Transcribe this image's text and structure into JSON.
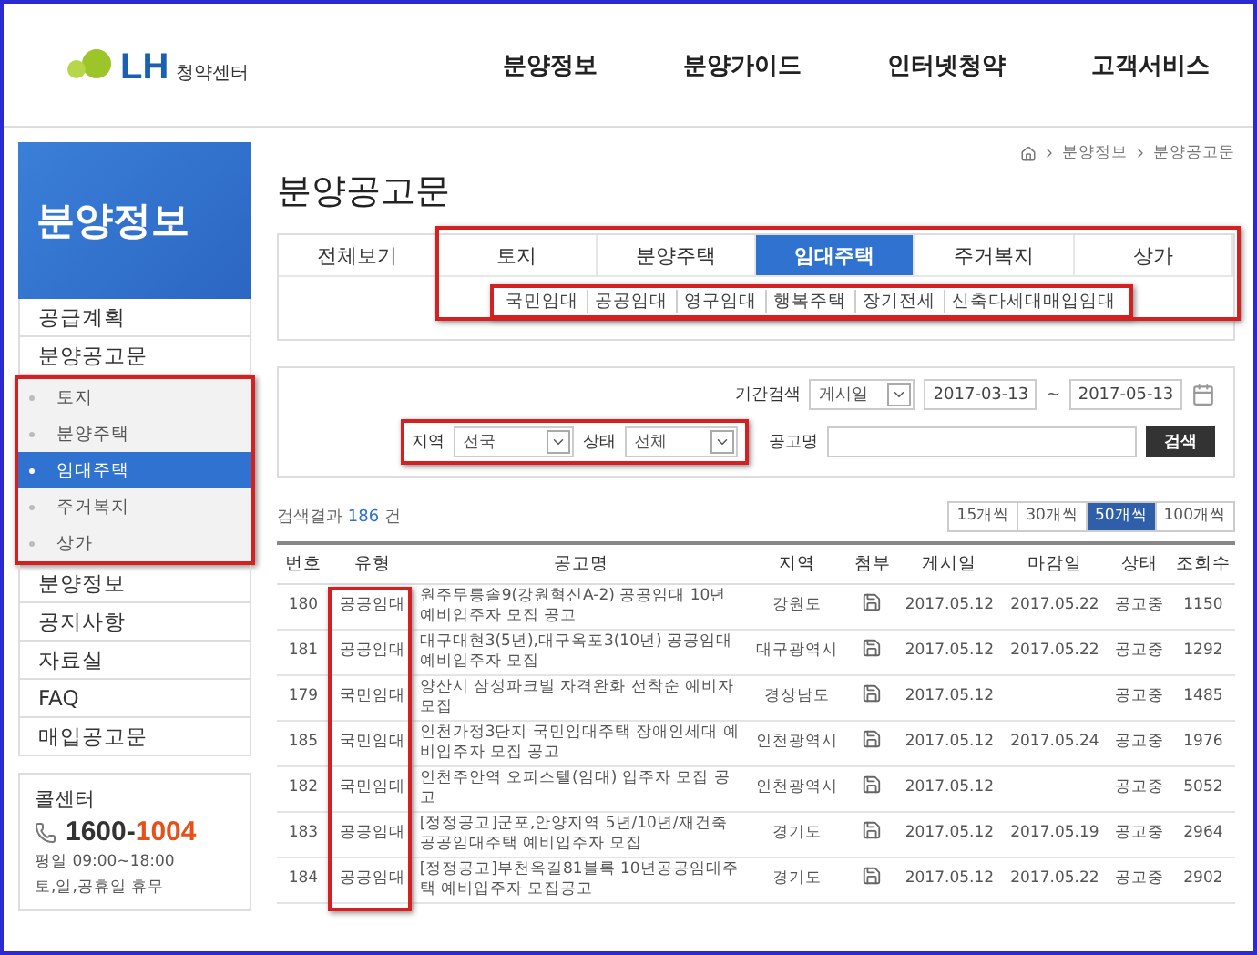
{
  "header": {
    "logo": {
      "brand": "LH",
      "sub": "청약센터"
    },
    "nav": [
      "분양정보",
      "분양가이드",
      "인터넷청약",
      "고객서비스"
    ]
  },
  "sidebar": {
    "title": "분양정보",
    "menu": [
      {
        "label": "공급계획"
      },
      {
        "label": "분양공고문",
        "children": [
          {
            "label": "토지",
            "selected": false
          },
          {
            "label": "분양주택",
            "selected": false
          },
          {
            "label": "임대주택",
            "selected": true
          },
          {
            "label": "주거복지",
            "selected": false
          },
          {
            "label": "상가",
            "selected": false
          }
        ]
      },
      {
        "label": "분양정보"
      },
      {
        "label": "공지사항"
      },
      {
        "label": "자료실"
      },
      {
        "label": "FAQ"
      },
      {
        "label": "매입공고문"
      }
    ],
    "call_center": {
      "title": "콜센터",
      "phone_prefix": "1600-",
      "phone_suffix": "1004",
      "hours": [
        "평일 09:00~18:00",
        "토,일,공휴일 휴무"
      ]
    }
  },
  "breadcrumb": [
    "분양정보",
    "분양공고문"
  ],
  "page_title": "분양공고문",
  "tabs": [
    {
      "label": "전체보기",
      "selected": false
    },
    {
      "label": "토지",
      "selected": false
    },
    {
      "label": "분양주택",
      "selected": false
    },
    {
      "label": "임대주택",
      "selected": true
    },
    {
      "label": "주거복지",
      "selected": false
    },
    {
      "label": "상가",
      "selected": false
    }
  ],
  "subtabs": [
    "국민임대",
    "공공임대",
    "영구임대",
    "행복주택",
    "장기전세",
    "신축다세대매입임대"
  ],
  "filters": {
    "period_label": "기간검색",
    "period_type": "게시일",
    "date_from": "2017-03-13",
    "date_separator": "~",
    "date_to": "2017-05-13",
    "region_label": "지역",
    "region": "전국",
    "status_label": "상태",
    "status": "전체",
    "title_label": "공고명",
    "search_button": "검색"
  },
  "result": {
    "prefix": "검색결과",
    "count": "186",
    "suffix": "건"
  },
  "page_sizes": [
    {
      "label": "15개씩",
      "selected": false
    },
    {
      "label": "30개씩",
      "selected": false
    },
    {
      "label": "50개씩",
      "selected": true
    },
    {
      "label": "100개씩",
      "selected": false
    }
  ],
  "table": {
    "columns": [
      "번호",
      "유형",
      "공고명",
      "지역",
      "첨부",
      "게시일",
      "마감일",
      "상태",
      "조회수"
    ],
    "rows": [
      {
        "no": "180",
        "type": "공공임대",
        "title": "원주무릉솔9(강원혁신A-2) 공공임대 10년 예비입주자 모집 공고",
        "region": "강원도",
        "attachment": true,
        "posted": "2017.05.12",
        "deadline": "2017.05.22",
        "status": "공고중",
        "views": "1150"
      },
      {
        "no": "181",
        "type": "공공임대",
        "title": "대구대현3(5년),대구옥포3(10년) 공공임대 예비입주자 모집",
        "region": "대구광역시",
        "attachment": true,
        "posted": "2017.05.12",
        "deadline": "2017.05.22",
        "status": "공고중",
        "views": "1292"
      },
      {
        "no": "179",
        "type": "국민임대",
        "title": "양산시 삼성파크빌 자격완화 선착순 예비자모집",
        "region": "경상남도",
        "attachment": true,
        "posted": "2017.05.12",
        "status": "공고중",
        "views": "1485"
      },
      {
        "no": "185",
        "type": "국민임대",
        "title": "인천가정3단지 국민임대주택 장애인세대 예비입주자 모집 공고",
        "region": "인천광역시",
        "attachment": true,
        "posted": "2017.05.12",
        "deadline": "2017.05.24",
        "status": "공고중",
        "views": "1976"
      },
      {
        "no": "182",
        "type": "국민임대",
        "title": "인천주안역 오피스텔(임대) 입주자 모집 공고",
        "region": "인천광역시",
        "attachment": true,
        "posted": "2017.05.12",
        "status": "공고중",
        "views": "5052"
      },
      {
        "no": "183",
        "type": "공공임대",
        "title": "[정정공고]군포,안양지역 5년/10년/재건축 공공임대주택 예비입주자 모집",
        "region": "경기도",
        "attachment": true,
        "posted": "2017.05.12",
        "deadline": "2017.05.19",
        "status": "공고중",
        "views": "2964"
      },
      {
        "no": "184",
        "type": "공공임대",
        "title": "[정정공고]부천옥길81블록 10년공공임대주택 예비입주자 모집공고",
        "region": "경기도",
        "attachment": true,
        "posted": "2017.05.12",
        "deadline": "2017.05.22",
        "status": "공고중",
        "views": "2902"
      }
    ]
  }
}
